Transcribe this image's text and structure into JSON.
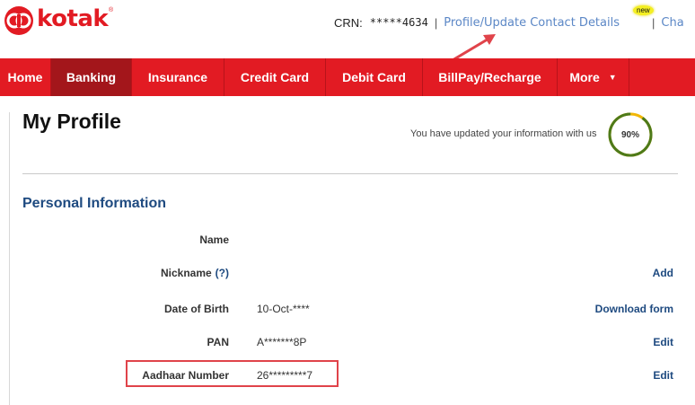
{
  "brand": {
    "name": "kotak",
    "reg_mark": "®"
  },
  "header": {
    "crn_label": "CRN:",
    "crn_value": "*****4634",
    "separator": "|",
    "profile_link": "Profile/Update Contact Details",
    "new_badge": "new",
    "truncated_link": "Cha"
  },
  "nav": {
    "items": [
      {
        "label": "Home"
      },
      {
        "label": "Banking"
      },
      {
        "label": "Insurance"
      },
      {
        "label": "Credit Card"
      },
      {
        "label": "Debit Card"
      },
      {
        "label": "BillPay/Recharge"
      },
      {
        "label": "More"
      }
    ],
    "active_index": 1,
    "more_caret": "▼"
  },
  "profile": {
    "title": "My Profile",
    "progress_text": "You have updated your information with us",
    "progress_label": "90%",
    "progress_value": 90
  },
  "personal": {
    "title": "Personal Information",
    "rows": [
      {
        "label": "Name",
        "value": "",
        "action": ""
      },
      {
        "label": "Nickname",
        "help": "(?)",
        "value": "",
        "action": "Add"
      },
      {
        "label": "Date of Birth",
        "value": "10-Oct-****",
        "action": "Download form"
      },
      {
        "label": "PAN",
        "value": "A*******8P",
        "action": "Edit"
      },
      {
        "label": "Aadhaar Number",
        "value": "26*********7",
        "action": "Edit"
      }
    ]
  },
  "colors": {
    "brand_red": "#e21b23",
    "active_tab": "#a3161b",
    "link_blue": "#5b87c6",
    "heading_blue": "#1e4a80",
    "ring_green": "#4d7a1a",
    "ring_yellow": "#f2b705",
    "annotation_red": "#e0434a"
  },
  "icons": {
    "logo": "kotak-logo-icon",
    "caret": "caret-down-icon"
  }
}
